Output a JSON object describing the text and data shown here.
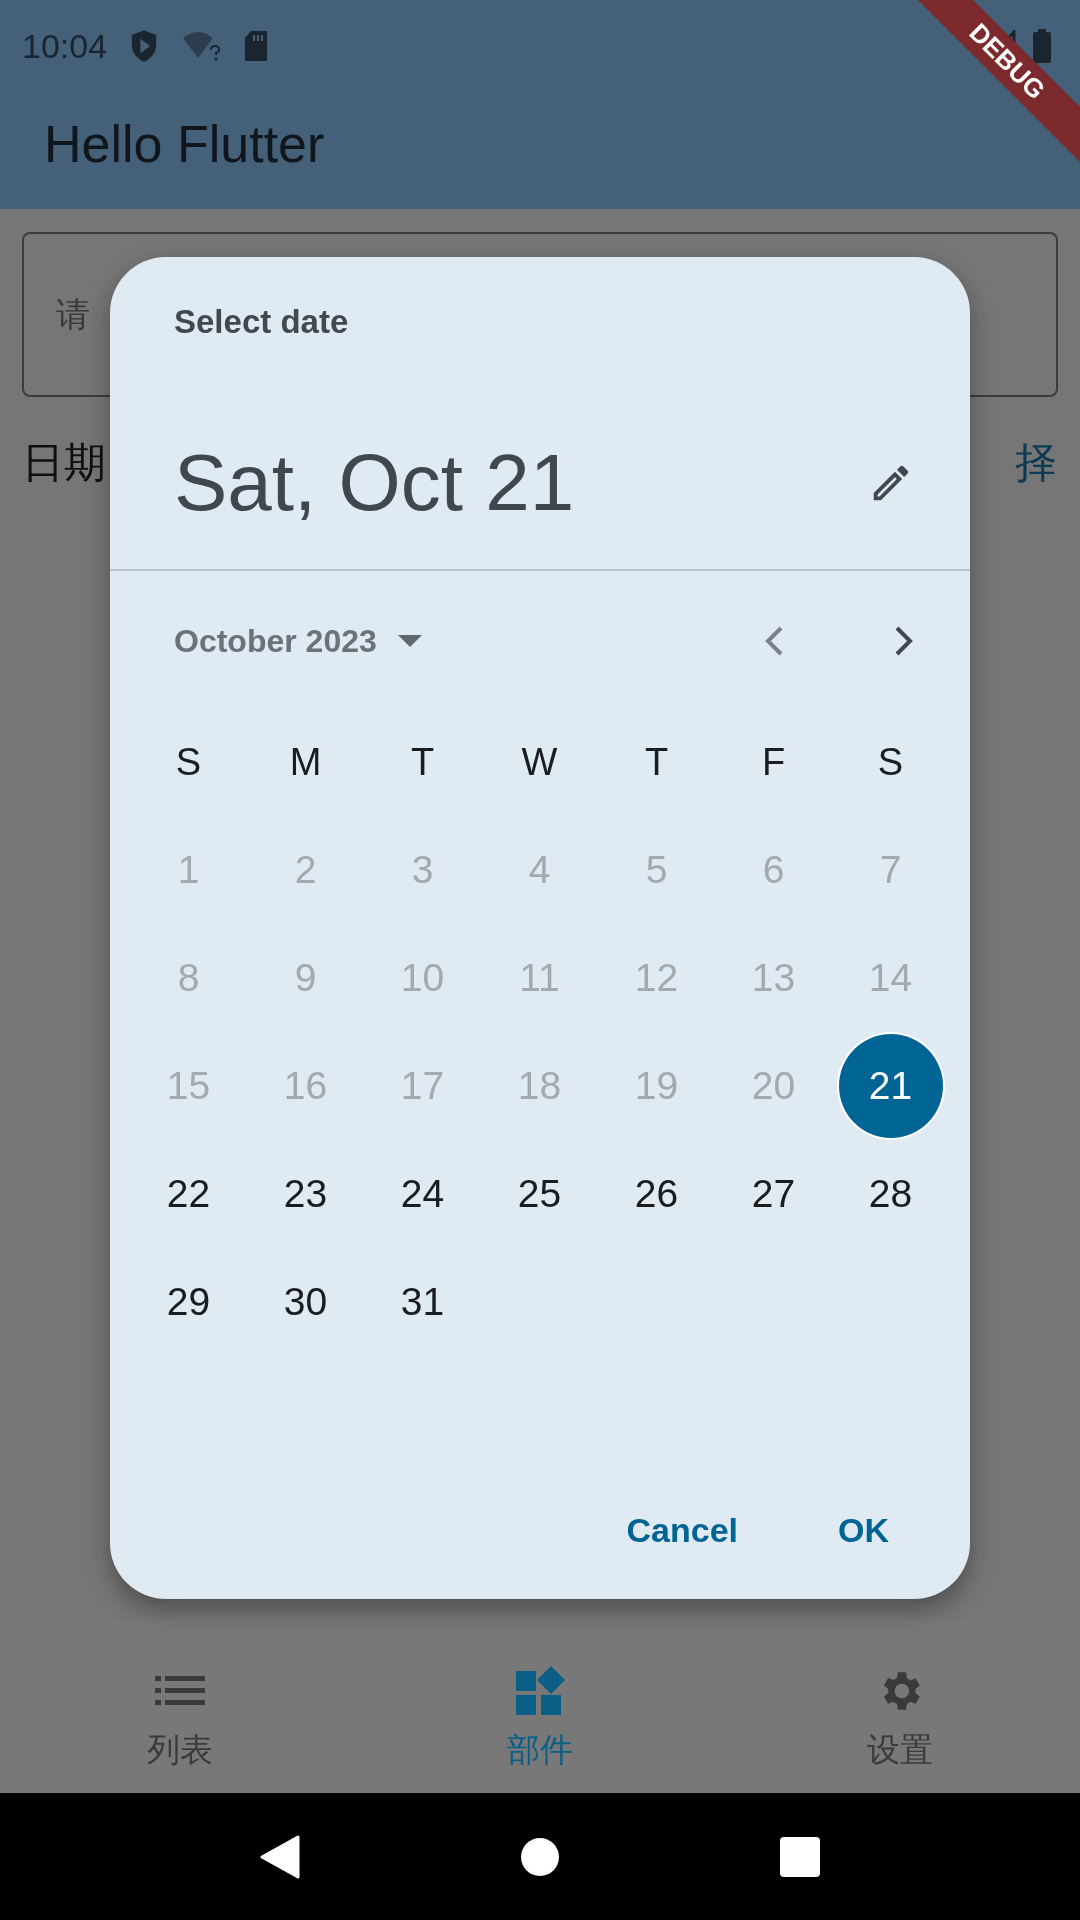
{
  "status_bar": {
    "time": "10:04"
  },
  "debug_banner": "DEBUG",
  "app_bar": {
    "title": "Hello Flutter"
  },
  "page": {
    "input": {
      "placeholder": "请"
    },
    "date_label": "日期",
    "pick_button": "择"
  },
  "dialog": {
    "header": "Select date",
    "selected_date": "Sat, Oct 21",
    "month": "October 2023",
    "weekdays": [
      "S",
      "M",
      "T",
      "W",
      "T",
      "F",
      "S"
    ],
    "days": [
      {
        "label": "1",
        "disabled": true,
        "selected": false
      },
      {
        "label": "2",
        "disabled": true,
        "selected": false
      },
      {
        "label": "3",
        "disabled": true,
        "selected": false
      },
      {
        "label": "4",
        "disabled": true,
        "selected": false
      },
      {
        "label": "5",
        "disabled": true,
        "selected": false
      },
      {
        "label": "6",
        "disabled": true,
        "selected": false
      },
      {
        "label": "7",
        "disabled": true,
        "selected": false
      },
      {
        "label": "8",
        "disabled": true,
        "selected": false
      },
      {
        "label": "9",
        "disabled": true,
        "selected": false
      },
      {
        "label": "10",
        "disabled": true,
        "selected": false
      },
      {
        "label": "11",
        "disabled": true,
        "selected": false
      },
      {
        "label": "12",
        "disabled": true,
        "selected": false
      },
      {
        "label": "13",
        "disabled": true,
        "selected": false
      },
      {
        "label": "14",
        "disabled": true,
        "selected": false
      },
      {
        "label": "15",
        "disabled": true,
        "selected": false
      },
      {
        "label": "16",
        "disabled": true,
        "selected": false
      },
      {
        "label": "17",
        "disabled": true,
        "selected": false
      },
      {
        "label": "18",
        "disabled": true,
        "selected": false
      },
      {
        "label": "19",
        "disabled": true,
        "selected": false
      },
      {
        "label": "20",
        "disabled": true,
        "selected": false
      },
      {
        "label": "21",
        "disabled": false,
        "selected": true
      },
      {
        "label": "22",
        "disabled": false,
        "selected": false
      },
      {
        "label": "23",
        "disabled": false,
        "selected": false
      },
      {
        "label": "24",
        "disabled": false,
        "selected": false
      },
      {
        "label": "25",
        "disabled": false,
        "selected": false
      },
      {
        "label": "26",
        "disabled": false,
        "selected": false
      },
      {
        "label": "27",
        "disabled": false,
        "selected": false
      },
      {
        "label": "28",
        "disabled": false,
        "selected": false
      },
      {
        "label": "29",
        "disabled": false,
        "selected": false
      },
      {
        "label": "30",
        "disabled": false,
        "selected": false
      },
      {
        "label": "31",
        "disabled": false,
        "selected": false
      }
    ],
    "buttons": [
      "Cancel",
      "OK"
    ]
  },
  "bottom_nav": [
    {
      "label": "列表",
      "selected": false
    },
    {
      "label": "部件",
      "selected": true
    },
    {
      "label": "设置",
      "selected": false
    }
  ]
}
